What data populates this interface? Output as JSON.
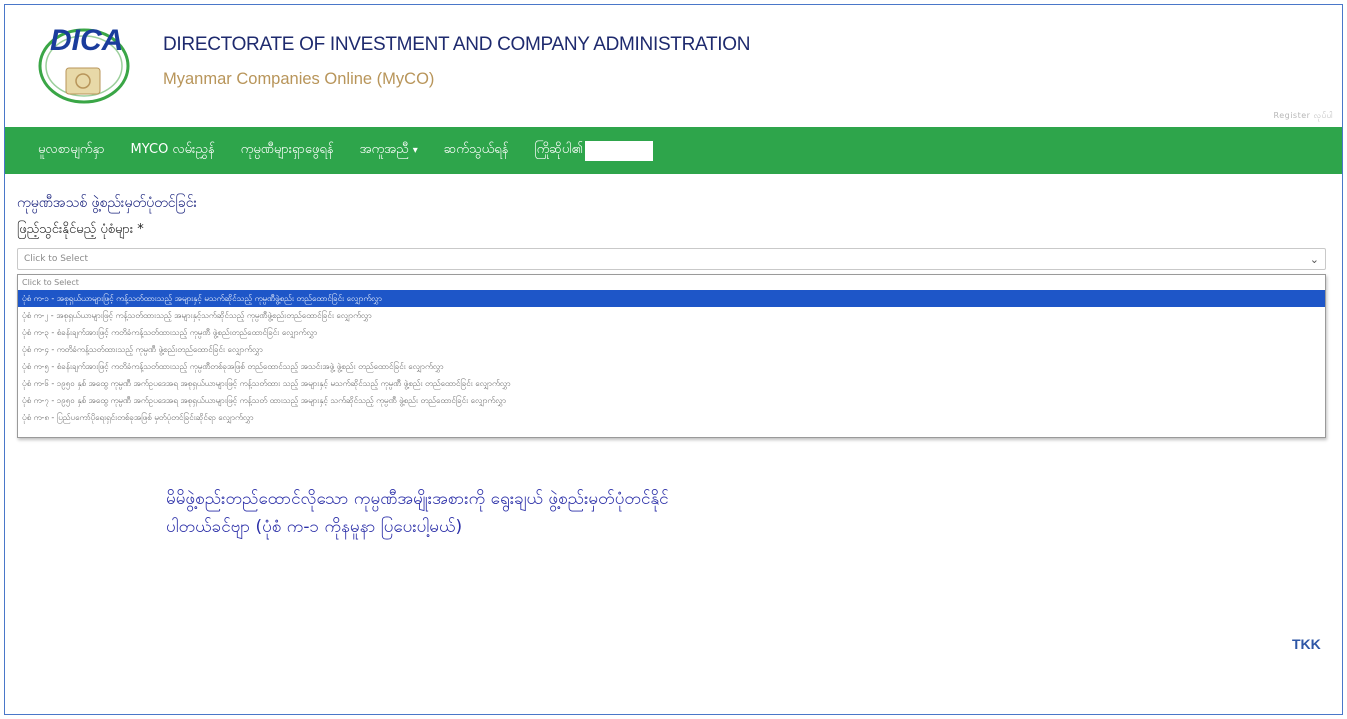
{
  "header": {
    "logo_text": "DICA",
    "title": "DIRECTORATE OF INVESTMENT AND COMPANY ADMINISTRATION",
    "subtitle": "Myanmar Companies Online (MyCO)"
  },
  "register_link": "Register လုပ်ပါ",
  "nav": {
    "items": [
      {
        "label": "မူလစာမျက်နှာ"
      },
      {
        "label": "MYCO လမ်းညွှန်"
      },
      {
        "label": "ကုမ္ပဏီများရှာဖွေရန်"
      },
      {
        "label": "အကူအညီ"
      },
      {
        "label": "ဆက်သွယ်ရန်"
      },
      {
        "label": "ကြိုဆိုပါ၏"
      }
    ]
  },
  "form": {
    "page_title": "ကုမ္ပဏီအသစ် ဖွဲ့စည်းမှတ်ပုံတင်ခြင်း",
    "field_label": "ဖြည့်သွင်းနိုင်မည့် ပုံစံများ *",
    "select_value": "Click to Select",
    "options": [
      "Click to Select",
      "ပုံစံ က-၁ - အစုရှယ်ယာများဖြင့် ကန့်သတ်ထားသည့် အများနှင့် မသက်ဆိုင်သည့် ကုမ္ပဏီဖွဲ့စည်း တည်ထောင်ခြင်း လျှောက်လွှာ",
      "ပုံစံ က-၂ - အစုရှယ်ယာများဖြင့် ကန့်သတ်ထားသည့် အများနှင့်သက်ဆိုင်သည့် ကုမ္ပဏီဖွဲ့စည်းတည်ထောင်ခြင်း လျှောက်လွှာ",
      "ပုံစံ က-၃ - စံခန်းချက်အားဖြင့် ကတိခံကန့်သတ်ထားသည့် ကုမ္ပဏီ ဖွဲ့စည်းတည်ထောင်ခြင်း လျှောက်လွှာ",
      "ပုံစံ က-၄ - ကတိခံကန့်သတ်ထားသည့် ကုမ္ပဏီ ဖွဲ့စည်းတည်ထောင်ခြင်း လျှောက်လွှာ",
      "ပုံစံ က-၅ - စံခန်းချက်အားဖြင့် ကတိခံကန့်သတ်ထားသည့် ကုမ္ပဏီတစ်ခုအဖြစ် တည်ထောင်သည့် အသင်းအဖွဲ့ ဖွဲ့စည်း တည်ထောင်ခြင်း လျှောက်လွှာ",
      "ပုံစံ က-၆ - ၁၉၅၀ နှစ် အထွေ ကုမ္ပဏီ အက်ဥပဒေအရ အစုရှယ်ယာများဖြင့် ကန့်သတ်ထား သည့် အများနှင့် မသက်ဆိုင်သည့် ကုမ္ပဏီ ဖွဲ့စည်း တည်ထောင်ခြင်း လျှောက်လွှာ",
      "ပုံစံ က-၇ - ၁၉၅၀ နှစ် အထွေ ကုမ္ပဏီ အက်ဥပဒေအရ အစုရှယ်ယာများဖြင့် ကန့်သတ် ထားသည့် အများနှင့် သက်ဆိုင်သည့် ကုမ္ပဏီ ဖွဲ့စည်း တည်ထောင်ခြင်း လျှောက်လွှာ",
      "ပုံစံ က-၈ - ပြည်ပကော်ပိုရေးရှင်းတစ်ခုအဖြစ် မှတ်ပုံတင်ခြင်းဆိုင်ရာ လျှောက်လွှာ"
    ],
    "selected_index": 1
  },
  "note": {
    "line1": "မိမိဖွဲ့စည်းတည်ထောင်လိုသော ကုမ္ပဏီအမျိုးအစားကို ရွေးချယ် ဖွဲ့စည်းမှတ်ပုံတင်နိုင်",
    "line2": "ပါတယ်ခင်ဗျာ (ပုံစံ က-၁ ကိုနမူနာ ပြပေးပါ့မယ်)"
  },
  "signature": "TKK",
  "colors": {
    "nav_bg": "#2ea54b",
    "selected_bg": "#1e56c8",
    "title_color": "#1e2a6e",
    "subtitle_color": "#b8955a",
    "note_color": "#2b2fa8"
  }
}
